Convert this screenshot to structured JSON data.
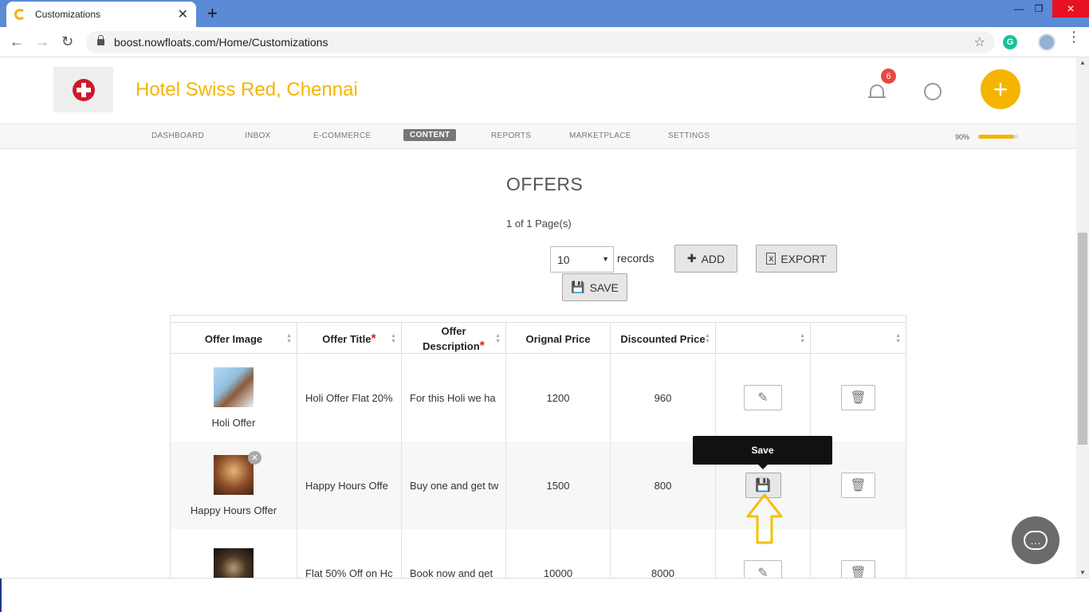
{
  "browser": {
    "tab_title": "Customizations",
    "tab_close": "✕",
    "new_tab": "+",
    "url": "boost.nowfloats.com/Home/Customizations",
    "extension_letter": "G"
  },
  "header": {
    "hotel_name": "Hotel Swiss Red, Chennai",
    "notification_count": "6",
    "fab_label": "+"
  },
  "menu": {
    "items": [
      {
        "label": "DASHBOARD"
      },
      {
        "label": "INBOX"
      },
      {
        "label": "E-COMMERCE"
      },
      {
        "label": "CONTENT"
      },
      {
        "label": "REPORTS"
      },
      {
        "label": "MARKETPLACE"
      },
      {
        "label": "SETTINGS"
      }
    ],
    "active": "CONTENT",
    "progress_label": "90%",
    "progress_value": 0.9
  },
  "offers": {
    "title": "OFFERS",
    "pager": "1 of 1 Page(s)",
    "page_size": "10",
    "records_label": "records",
    "add_label": "ADD",
    "export_label": "EXPORT",
    "save_label": "SAVE"
  },
  "table": {
    "columns": [
      {
        "label": "Offer Image",
        "required": ""
      },
      {
        "label": "Offer Title",
        "required": "*"
      },
      {
        "label": "Offer Description",
        "required": "*"
      },
      {
        "label": "Orignal Price",
        "required": ""
      },
      {
        "label": "Discounted Price",
        "required": ""
      },
      {
        "label": "",
        "required": ""
      },
      {
        "label": "",
        "required": ""
      }
    ],
    "rows": [
      {
        "image_label": "Holi Offer",
        "title": "Holi Offer Flat 20%",
        "description": "For this Holi we ha",
        "original_price": "1200",
        "discounted_price": "960",
        "action": "edit"
      },
      {
        "image_label": "Happy Hours Offer",
        "title": "Happy Hours Offe",
        "description": "Buy one and get tw",
        "original_price": "1500",
        "discounted_price": "800",
        "action": "save"
      },
      {
        "image_label": "",
        "title": "Flat 50% Off on Hc",
        "description": "Book now and get",
        "original_price": "10000",
        "discounted_price": "8000",
        "action": "edit"
      }
    ]
  },
  "tooltip": {
    "text": "Save"
  },
  "colors": {
    "accent": "#f5b400",
    "brand_red": "#d0182a",
    "badge": "#e8483f",
    "chrome": "#5b8bd6"
  }
}
